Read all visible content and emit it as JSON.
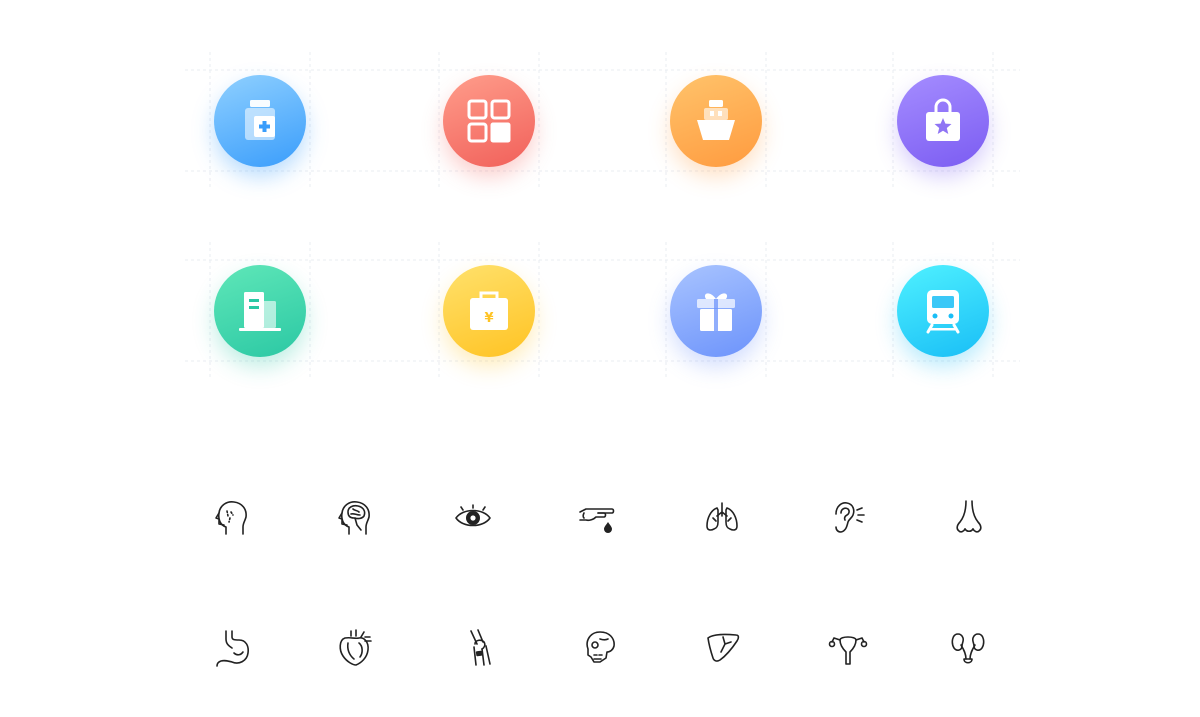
{
  "colors": {
    "medicine": [
      "#8fd0ff",
      "#3a9dfb"
    ],
    "apps": [
      "#ff9d8b",
      "#f1605a"
    ],
    "ship": [
      "#ffc36b",
      "#ff9b3f"
    ],
    "bag": [
      "#a58dff",
      "#7b5cf2"
    ],
    "building": [
      "#5fe7b8",
      "#2bc8a4"
    ],
    "payment": [
      "#ffe16c",
      "#ffc323"
    ],
    "gift": [
      "#a9c4ff",
      "#6c93fb"
    ],
    "train": [
      "#4ff1ff",
      "#19bef6"
    ],
    "line_stroke": "#222222",
    "grid": "#e9ecf2"
  },
  "colored_icons": [
    "medicine-bottle-icon",
    "app-grid-icon",
    "ship-icon",
    "shopping-bag-star-icon",
    "building-icon",
    "yen-briefcase-icon",
    "gift-box-icon",
    "train-icon"
  ],
  "payment_icon": {
    "symbol": "¥"
  },
  "line_icons": [
    "head-face-icon",
    "brain-head-icon",
    "eye-icon",
    "finger-blood-drop-icon",
    "lungs-icon",
    "ear-icon",
    "nose-icon",
    "stomach-icon",
    "heart-icon",
    "knee-joint-icon",
    "skull-icon",
    "liver-icon",
    "uterus-icon",
    "kidneys-icon"
  ]
}
